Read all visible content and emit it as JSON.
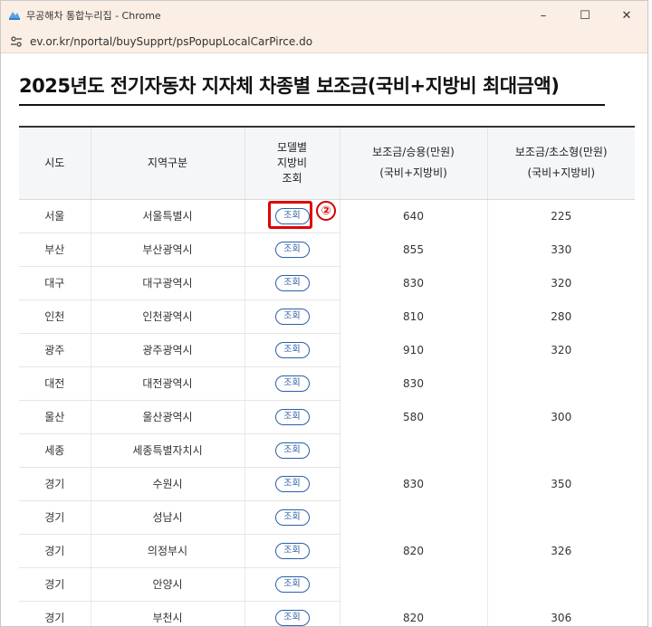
{
  "window": {
    "title": "무공해차 통합누리집 - Chrome",
    "url": "ev.or.kr/nportal/buySupprt/psPopupLocalCarPirce.do",
    "minimize": "–",
    "maximize": "☐",
    "close": "✕"
  },
  "page": {
    "title": "2025년도 전기자동차 지자체 차종별 보조금(국비+지방비 최대금액)"
  },
  "table": {
    "headers": {
      "province": "시도",
      "region": "지역구분",
      "lookup_1": "모델별",
      "lookup_2": "지방비",
      "lookup_3": "조회",
      "passenger_1": "보조금/승용(만원)",
      "passenger_2": "(국비+지방비)",
      "compact_1": "보조금/초소형(만원)",
      "compact_2": "(국비+지방비)"
    },
    "lookup_label": "조회",
    "rows": [
      {
        "province": "서울",
        "region": "서울특별시",
        "passenger": "640",
        "compact": "225"
      },
      {
        "province": "부산",
        "region": "부산광역시",
        "passenger": "855",
        "compact": "330"
      },
      {
        "province": "대구",
        "region": "대구광역시",
        "passenger": "830",
        "compact": "320"
      },
      {
        "province": "인천",
        "region": "인천광역시",
        "passenger": "810",
        "compact": "280"
      },
      {
        "province": "광주",
        "region": "광주광역시",
        "passenger": "910",
        "compact": "320"
      },
      {
        "province": "대전",
        "region": "대전광역시",
        "passenger": "830",
        "compact": ""
      },
      {
        "province": "울산",
        "region": "울산광역시",
        "passenger": "580",
        "compact": "300"
      },
      {
        "province": "세종",
        "region": "세종특별자치시",
        "passenger": "",
        "compact": ""
      },
      {
        "province": "경기",
        "region": "수원시",
        "passenger": "830",
        "compact": "350"
      },
      {
        "province": "경기",
        "region": "성남시",
        "passenger": "",
        "compact": ""
      },
      {
        "province": "경기",
        "region": "의정부시",
        "passenger": "820",
        "compact": "326"
      },
      {
        "province": "경기",
        "region": "안양시",
        "passenger": "",
        "compact": ""
      },
      {
        "province": "경기",
        "region": "부천시",
        "passenger": "820",
        "compact": "306"
      }
    ]
  },
  "annotation": {
    "marker": "②",
    "color": "#e00000"
  }
}
